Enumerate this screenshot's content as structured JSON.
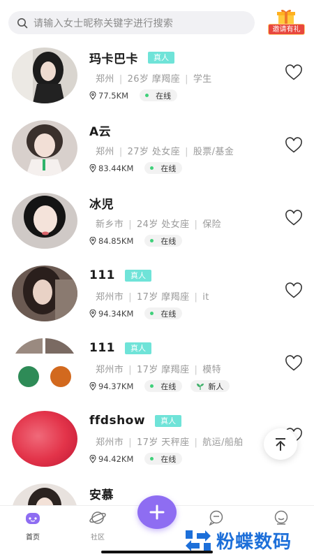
{
  "search": {
    "placeholder": "请输入女士昵称关键字进行搜索"
  },
  "invite": {
    "label": "邀请有礼"
  },
  "profiles": [
    {
      "name": "玛卡巴卡",
      "verified": "真人",
      "city": "郑州",
      "age": "26岁",
      "zodiac": "摩羯座",
      "job": "学生",
      "distance": "77.5KM",
      "status": "在线",
      "new_badge": ""
    },
    {
      "name": "A云",
      "verified": "",
      "city": "郑州",
      "age": "27岁",
      "zodiac": "处女座",
      "job": "股票/基金",
      "distance": "83.44KM",
      "status": "在线",
      "new_badge": ""
    },
    {
      "name": "冰児",
      "verified": "",
      "city": "新乡市",
      "age": "24岁",
      "zodiac": "处女座",
      "job": "保险",
      "distance": "84.85KM",
      "status": "在线",
      "new_badge": ""
    },
    {
      "name": "111",
      "verified": "真人",
      "city": "郑州市",
      "age": "17岁",
      "zodiac": "摩羯座",
      "job": "it",
      "distance": "94.34KM",
      "status": "在线",
      "new_badge": ""
    },
    {
      "name": "111",
      "verified": "真人",
      "city": "郑州市",
      "age": "17岁",
      "zodiac": "摩羯座",
      "job": "模特",
      "distance": "94.37KM",
      "status": "在线",
      "new_badge": "新人"
    },
    {
      "name": "ffdshow",
      "verified": "真人",
      "city": "郑州市",
      "age": "17岁",
      "zodiac": "天秤座",
      "job": "航运/船舶",
      "distance": "94.42KM",
      "status": "在线",
      "new_badge": ""
    },
    {
      "name": "安慕",
      "verified": "",
      "city": "",
      "age": "",
      "zodiac": "",
      "job": "",
      "distance": "",
      "status": "",
      "new_badge": ""
    }
  ],
  "tabs": [
    {
      "label": "首页",
      "icon": "home-icon"
    },
    {
      "label": "社区",
      "icon": "planet-icon"
    },
    {
      "label": "",
      "icon": "chat-icon"
    },
    {
      "label": "",
      "icon": "profile-icon"
    }
  ],
  "watermark": {
    "text": "粉蝶数码"
  },
  "colors": {
    "accent": "#8e6df2",
    "verified": "#6fe3d8",
    "online": "#3fd07a"
  }
}
